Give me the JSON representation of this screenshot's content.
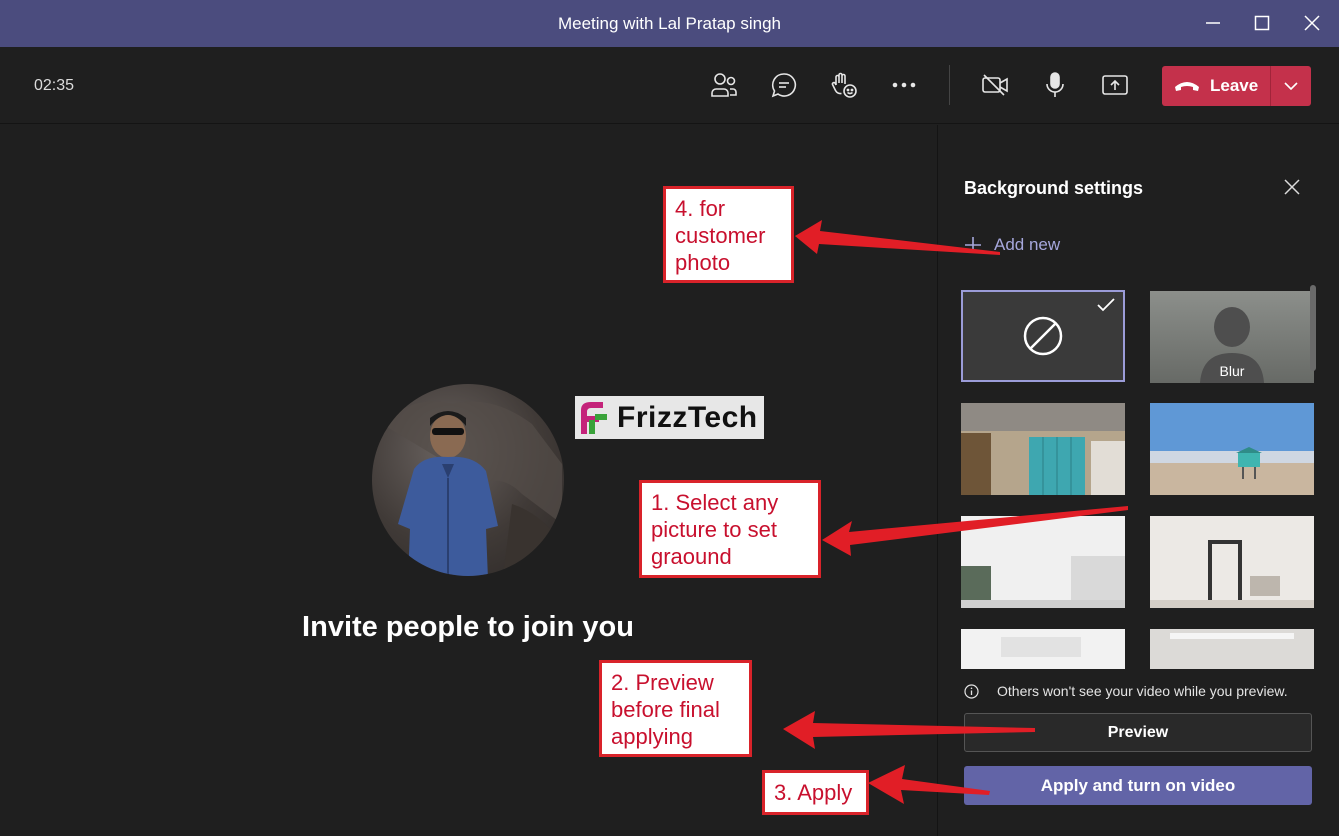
{
  "window": {
    "title": "Meeting with Lal Pratap singh"
  },
  "toolbar": {
    "timer": "02:35",
    "leave_label": "Leave"
  },
  "stage": {
    "invite_text": "Invite people to join you",
    "logo_text": "FrizzTech"
  },
  "panel": {
    "title": "Background settings",
    "add_new_label": "Add new",
    "blur_label": "Blur",
    "info_text": "Others won't see your video while you preview.",
    "preview_label": "Preview",
    "apply_label": "Apply and turn on video"
  },
  "annotations": {
    "step4": [
      "4. for",
      "customer",
      "photo"
    ],
    "step1": [
      "1. Select any",
      "picture to set",
      "graound"
    ],
    "step2": [
      "2. Preview",
      "before final",
      "applying"
    ],
    "step3": [
      "3. Apply"
    ]
  },
  "colors": {
    "titlebar": "#4b4c7e",
    "accent": "#6264a7",
    "leave": "#c4314b",
    "annotation": "#d9232a"
  }
}
